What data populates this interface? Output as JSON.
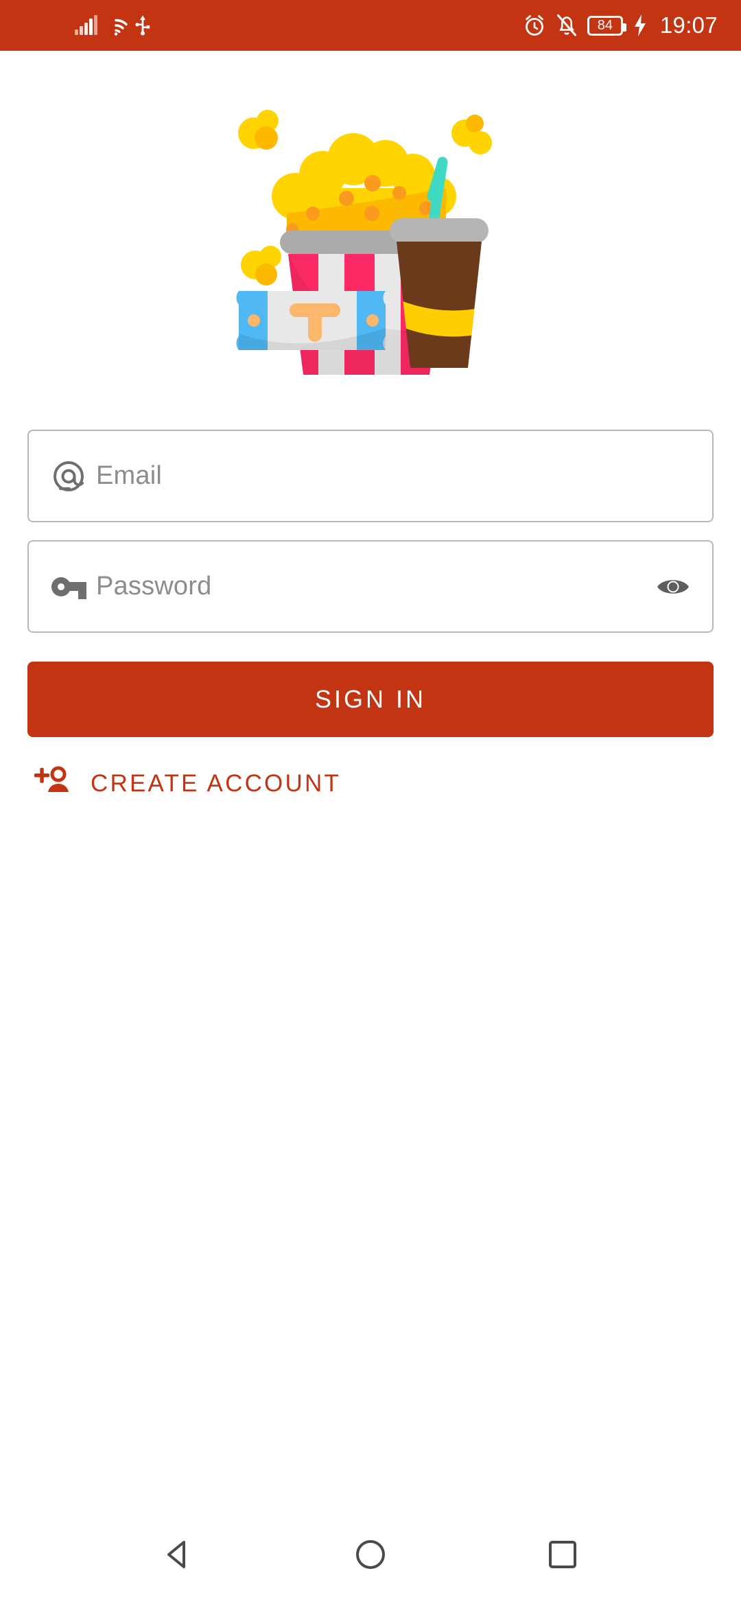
{
  "status_bar": {
    "background": "#C23412",
    "time": "19:07",
    "battery_level": "84",
    "icons": {
      "signal": "signal-bars-icon",
      "wifi": "wifi-icon",
      "usb": "usb-icon",
      "alarm": "alarm-clock-icon",
      "mute": "bell-muted-icon",
      "battery": "battery-icon",
      "charging": "charging-bolt-icon"
    }
  },
  "hero": {
    "name": "popcorn-cinema-illustration",
    "colors": {
      "popcorn_light": "#FFD400",
      "popcorn_dark": "#FCB900",
      "kernel": "#FA9A1E",
      "bucket_stripe": "#FC2A64",
      "bucket_stripe_dark": "#E01F55",
      "bucket_white": "#E8E8E8",
      "bucket_rim": "#ABABAB",
      "ticket_blue": "#4FB8F5",
      "ticket_blue_dark": "#3AA0E8",
      "ticket_paper": "#E8E8E8",
      "ticket_letter": "#FBB76B",
      "cup_body": "#6B3A1A",
      "cup_lid": "#B5B5B5",
      "cup_band": "#FFCE00",
      "straw": "#3FD9C4"
    },
    "ticket_letter": "T"
  },
  "form": {
    "email": {
      "icon": "at-sign-icon",
      "placeholder": "Email",
      "value": ""
    },
    "password": {
      "icon": "key-icon",
      "placeholder": "Password",
      "value": "",
      "reveal_icon": "eye-icon"
    },
    "border_color": "#B8B8B8",
    "placeholder_color": "#8C8C8C"
  },
  "actions": {
    "sign_in_label": "SIGN IN",
    "sign_in_color": "#C23412",
    "create_account_label": "CREATE ACCOUNT",
    "create_account_icon": "person-add-icon",
    "create_account_color": "#C23412"
  },
  "nav_bar": {
    "back": "back-triangle-icon",
    "home": "home-circle-icon",
    "recents": "recents-square-icon",
    "icon_color": "#4A4A4A"
  }
}
